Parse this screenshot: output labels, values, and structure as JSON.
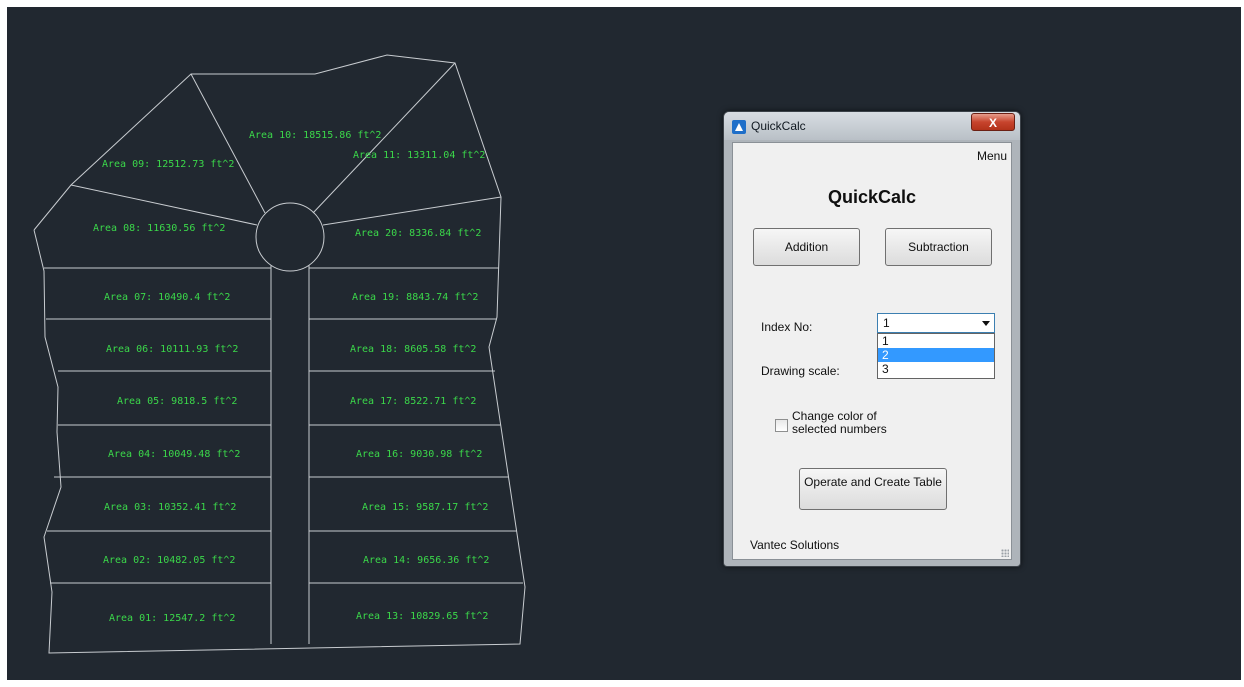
{
  "drawing": {
    "areas_left": [
      {
        "id": "area-09",
        "text": "Area 09: 12512.73 ft^2"
      },
      {
        "id": "area-10",
        "text": "Area 10: 18515.86 ft^2"
      },
      {
        "id": "area-08",
        "text": "Area 08: 11630.56 ft^2"
      },
      {
        "id": "area-07",
        "text": "Area 07: 10490.4 ft^2"
      },
      {
        "id": "area-06",
        "text": "Area 06: 10111.93 ft^2"
      },
      {
        "id": "area-05",
        "text": "Area 05: 9818.5 ft^2"
      },
      {
        "id": "area-04",
        "text": "Area 04: 10049.48 ft^2"
      },
      {
        "id": "area-03",
        "text": "Area 03: 10352.41 ft^2"
      },
      {
        "id": "area-02",
        "text": "Area 02: 10482.05 ft^2"
      },
      {
        "id": "area-01",
        "text": "Area 01: 12547.2 ft^2"
      }
    ],
    "areas_right": [
      {
        "id": "area-11",
        "text": "Area 11: 13311.04 ft^2"
      },
      {
        "id": "area-20",
        "text": "Area 20: 8336.84 ft^2"
      },
      {
        "id": "area-19",
        "text": "Area 19: 8843.74 ft^2"
      },
      {
        "id": "area-18",
        "text": "Area 18: 8605.58 ft^2"
      },
      {
        "id": "area-17",
        "text": "Area 17: 8522.71 ft^2"
      },
      {
        "id": "area-16",
        "text": "Area 16: 9030.98 ft^2"
      },
      {
        "id": "area-15",
        "text": "Area 15: 9587.17 ft^2"
      },
      {
        "id": "area-14",
        "text": "Area 14: 9656.36 ft^2"
      },
      {
        "id": "area-13",
        "text": "Area 13: 10829.65 ft^2"
      }
    ],
    "label_color": "#3bd84a",
    "line_color": "#c8ccd0",
    "background": "#212830"
  },
  "window": {
    "title": "QuickCalc",
    "close_label": "X",
    "menu_label": "Menu",
    "heading": "QuickCalc",
    "addition_label": "Addition",
    "subtraction_label": "Subtraction",
    "index_label": "Index No:",
    "index_selected": "1",
    "index_options": [
      "1",
      "2",
      "3"
    ],
    "index_highlighted": "2",
    "scale_label": "Drawing scale:",
    "checkbox_label": "Change color of selected numbers",
    "checkbox_checked": false,
    "operate_label": "Operate and Create Table",
    "footer": "Vantec Solutions"
  }
}
